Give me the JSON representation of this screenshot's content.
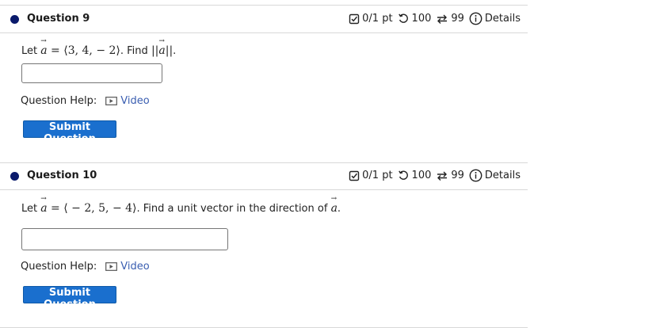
{
  "questions": [
    {
      "title": "Question 9",
      "score": "0/1 pt",
      "attempts_retry": "100",
      "attempts_versions": "99",
      "details_label": "Details",
      "prompt_prefix": "Let",
      "vector_name": "a",
      "vector_value": "⟨3, 4, − 2⟩",
      "prompt_mid": ". Find",
      "norm_open": "||",
      "norm_close": "||",
      "prompt_end": ".",
      "answer_value": "",
      "help_label": "Question Help:",
      "video_label": "Video",
      "submit_label": "Submit Question"
    },
    {
      "title": "Question 10",
      "score": "0/1 pt",
      "attempts_retry": "100",
      "attempts_versions": "99",
      "details_label": "Details",
      "prompt_prefix": "Let",
      "vector_name": "a",
      "vector_value": "⟨ − 2, 5, − 4⟩",
      "prompt_mid": ". Find a unit vector in the direction of",
      "prompt_end": ".",
      "answer_value": "",
      "help_label": "Question Help:",
      "video_label": "Video",
      "submit_label": "Submit Question"
    }
  ],
  "icons": {
    "score": "checkbox-icon",
    "retry": "retry-icon",
    "versions": "versions-icon",
    "details": "info-icon",
    "video": "video-icon"
  },
  "colors": {
    "bullet": "#0a1a6b",
    "submit_bg": "#1a6fce",
    "link": "#3a5eb1",
    "divider": "#d8d8d8"
  }
}
